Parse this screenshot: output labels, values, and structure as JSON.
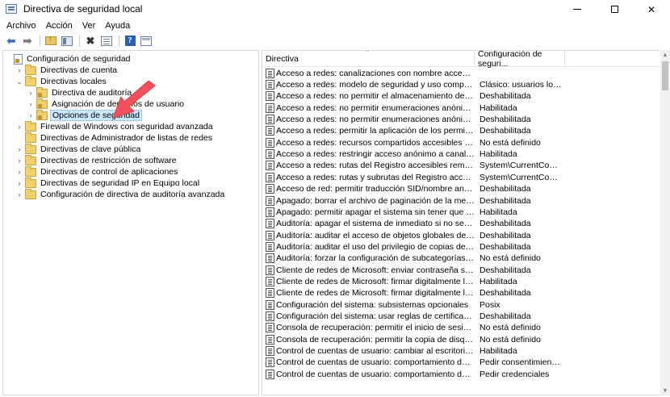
{
  "window": {
    "title": "Directiva de seguridad local"
  },
  "menu": [
    "Archivo",
    "Acción",
    "Ver",
    "Ayuda"
  ],
  "tree": [
    {
      "label": "Configuración de seguridad",
      "indent": 0,
      "expander": "",
      "icon": "root",
      "selected": false
    },
    {
      "label": "Directivas de cuenta",
      "indent": 1,
      "expander": "›",
      "icon": "folder",
      "selected": false
    },
    {
      "label": "Directivas locales",
      "indent": 1,
      "expander": "⌄",
      "icon": "folder",
      "selected": false
    },
    {
      "label": "Directiva de auditoría",
      "indent": 2,
      "expander": "›",
      "icon": "lockfolder",
      "selected": false
    },
    {
      "label": "Asignación de derechos de usuario",
      "indent": 2,
      "expander": "›",
      "icon": "lockfolder",
      "selected": false
    },
    {
      "label": "Opciones de seguridad",
      "indent": 2,
      "expander": "›",
      "icon": "lockfolder",
      "selected": true
    },
    {
      "label": "Firewall de Windows con seguridad avanzada",
      "indent": 1,
      "expander": "›",
      "icon": "folder",
      "selected": false
    },
    {
      "label": "Directivas de Administrador de listas de redes",
      "indent": 1,
      "expander": "",
      "icon": "folder",
      "selected": false
    },
    {
      "label": "Directivas de clave pública",
      "indent": 1,
      "expander": "›",
      "icon": "folder",
      "selected": false
    },
    {
      "label": "Directivas de restricción de software",
      "indent": 1,
      "expander": "›",
      "icon": "folder",
      "selected": false
    },
    {
      "label": "Directivas de control de aplicaciones",
      "indent": 1,
      "expander": "›",
      "icon": "folder",
      "selected": false
    },
    {
      "label": "Directivas de seguridad IP en Equipo local",
      "indent": 1,
      "expander": "›",
      "icon": "folder",
      "selected": false
    },
    {
      "label": "Configuración de directiva de auditoría avanzada",
      "indent": 1,
      "expander": "›",
      "icon": "folder",
      "selected": false
    }
  ],
  "list": {
    "columns": [
      "Directiva",
      "Configuración de seguri..."
    ],
    "rows": [
      [
        "Acceso a redes: canalizaciones con nombre accesibles anóni...",
        ""
      ],
      [
        "Acceso a redes: modelo de seguridad y uso compartido par...",
        "Clásico: usuarios locales..."
      ],
      [
        "Acceso a redes: no permitir el almacenamiento de contrase...",
        "Deshabilitada"
      ],
      [
        "Acceso a redes: no permitir enumeraciones anónimas de cu...",
        "Habilitada"
      ],
      [
        "Acceso a redes: no permitir enumeraciones anónimas de cu...",
        "Deshabilitada"
      ],
      [
        "Acceso a redes: permitir la aplicación de los permisos Todos...",
        "Deshabilitada"
      ],
      [
        "Acceso a redes: recursos compartidos accesibles anónimam...",
        "No está definido"
      ],
      [
        "Acceso a redes: restringir acceso anónimo a canalizaciones ...",
        "Habilitada"
      ],
      [
        "Acceso a redes: rutas del Registro accesibles remotamente",
        "System\\CurrentControlS..."
      ],
      [
        "Acceso a redes: rutas y subrutas del Registro accesibles rem...",
        "System\\CurrentControlS..."
      ],
      [
        "Acceso de red: permitir traducción SID/nombre anónima",
        "Deshabilitada"
      ],
      [
        "Apagado: borrar el archivo de paginación de la memoria virt...",
        "Deshabilitada"
      ],
      [
        "Apagado: permitir apagar el sistema sin tener que iniciar ses...",
        "Habilitada"
      ],
      [
        "Auditoría: apagar el sistema de inmediato si no se pueden re...",
        "Deshabilitada"
      ],
      [
        "Auditoría: auditar el acceso de objetos globales del sistema",
        "Deshabilitada"
      ],
      [
        "Auditoría: auditar el uso del privilegio de copias de segurida...",
        "Deshabilitada"
      ],
      [
        "Auditoría: forzar la configuración de subcategorías de la dire...",
        "No está definido"
      ],
      [
        "Cliente de redes de Microsoft: enviar contraseña sin cifrar a ...",
        "Deshabilitada"
      ],
      [
        "Cliente de redes de Microsoft: firmar digitalmente las comu...",
        "Habilitada"
      ],
      [
        "Cliente de redes de Microsoft: firmar digitalmente las comu...",
        "Deshabilitada"
      ],
      [
        "Configuración del sistema: subsistemas opcionales",
        "Posix"
      ],
      [
        "Configuración del sistema: usar reglas de certificado en ejec...",
        "Deshabilitada"
      ],
      [
        "Consola de recuperación: permitir el inicio de sesión admini...",
        "No está definido"
      ],
      [
        "Consola de recuperación: permitir la copia de disquetes y el ...",
        "No está definido"
      ],
      [
        "Control de cuentas de usuario: cambiar al escritorio seguro ...",
        "Habilitada"
      ],
      [
        "Control de cuentas de usuario: comportamiento de la petici...",
        "Pedir consentimiento par..."
      ],
      [
        "Control de cuentas de usuario: comportamiento de la petici...",
        "Pedir credenciales"
      ]
    ]
  },
  "colors": {
    "selection": "#cce8ff",
    "arrow": "#f2505c",
    "folder": "#f0cf6e"
  },
  "icons": [
    "back-arrow-icon",
    "forward-arrow-icon",
    "up-folder-icon",
    "show-tree-icon",
    "delete-icon",
    "properties-icon",
    "help-icon",
    "view-icon"
  ]
}
